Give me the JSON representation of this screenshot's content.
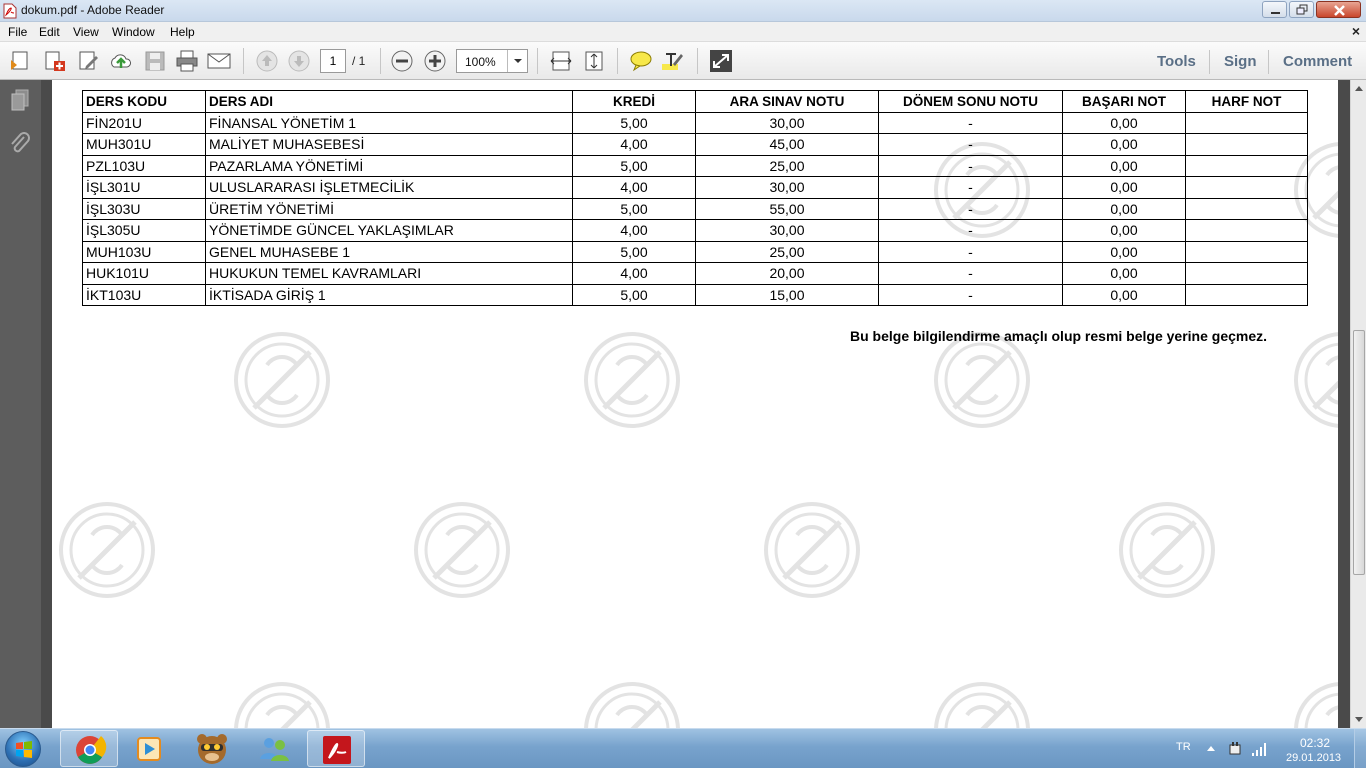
{
  "window": {
    "title": "dokum.pdf - Adobe Reader"
  },
  "menu": {
    "items": [
      "File",
      "Edit",
      "View",
      "Window",
      "Help"
    ],
    "close_glyph": "×"
  },
  "toolbar": {
    "page_current": "1",
    "page_total": "/ 1",
    "zoom": "100%",
    "tools_label": "Tools",
    "sign_label": "Sign",
    "comment_label": "Comment"
  },
  "table": {
    "headers": [
      "DERS KODU",
      "DERS ADI",
      "KREDİ",
      "ARA SINAV NOTU",
      "DÖNEM SONU NOTU",
      "BAŞARI NOT",
      "HARF NOT"
    ],
    "rows": [
      [
        "FİN201U",
        "FİNANSAL YÖNETİM 1",
        "5,00",
        "30,00",
        "-",
        "0,00",
        ""
      ],
      [
        "MUH301U",
        "MALİYET MUHASEBESİ",
        "4,00",
        "45,00",
        "-",
        "0,00",
        ""
      ],
      [
        "PZL103U",
        "PAZARLAMA YÖNETİMİ",
        "5,00",
        "25,00",
        "-",
        "0,00",
        ""
      ],
      [
        "İŞL301U",
        "ULUSLARARASI İŞLETMECİLİK",
        "4,00",
        "30,00",
        "-",
        "0,00",
        ""
      ],
      [
        "İŞL303U",
        "ÜRETİM YÖNETİMİ",
        "5,00",
        "55,00",
        "-",
        "0,00",
        ""
      ],
      [
        "İŞL305U",
        "YÖNETİMDE GÜNCEL YAKLAŞIMLAR",
        "4,00",
        "30,00",
        "-",
        "0,00",
        ""
      ],
      [
        "MUH103U",
        "GENEL MUHASEBE 1",
        "5,00",
        "25,00",
        "-",
        "0,00",
        ""
      ],
      [
        "HUK101U",
        "HUKUKUN TEMEL KAVRAMLARI",
        "4,00",
        "20,00",
        "-",
        "0,00",
        ""
      ],
      [
        "İKT103U",
        "İKTİSADA GİRİŞ 1",
        "5,00",
        "15,00",
        "-",
        "0,00",
        ""
      ]
    ]
  },
  "note": "Bu belge bilgilendirme amaçlı olup resmi belge yerine geçmez.",
  "taskbar": {
    "language": "TR",
    "time": "02:32",
    "date": "29.01.2013"
  }
}
